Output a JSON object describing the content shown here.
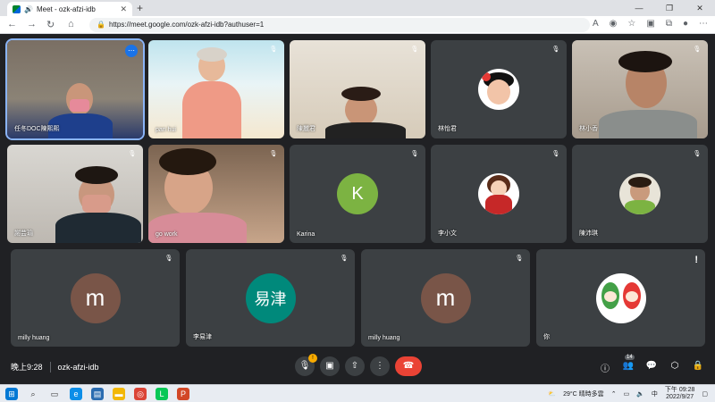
{
  "browser": {
    "tab_title": "Meet - ozk-afzi-idb",
    "new_tab": "+",
    "url": "https://meet.google.com/ozk-afzi-idb?authuser=1",
    "window_controls": [
      "—",
      "❐",
      "✕"
    ]
  },
  "tiles": [
    {
      "name": "任冬DOC陳熙熙",
      "kind": "video"
    },
    {
      "name": "pan hui",
      "kind": "video"
    },
    {
      "name": "陳麗君",
      "kind": "video"
    },
    {
      "name": "林怡君",
      "kind": "picture"
    },
    {
      "name": "林小香",
      "kind": "video"
    },
    {
      "name": "謝芸瑜",
      "kind": "video"
    },
    {
      "name": "go work",
      "kind": "video"
    },
    {
      "name": "Karina",
      "kind": "letter",
      "letter": "K",
      "color": "#7cb342"
    },
    {
      "name": "李小文",
      "kind": "picture"
    },
    {
      "name": "陳沛琪",
      "kind": "picture"
    },
    {
      "name": "milly huang",
      "kind": "letter",
      "letter": "m",
      "color": "#795548"
    },
    {
      "name": "李易津",
      "kind": "letter",
      "letter": "易津",
      "color": "#00897b"
    },
    {
      "name": "milly huang",
      "kind": "letter",
      "letter": "m",
      "color": "#795548"
    },
    {
      "name": "你",
      "kind": "picture"
    }
  ],
  "bottom": {
    "time": "晚上9:28",
    "meeting_code": "ozk-afzi-idb",
    "mic_badge": "!",
    "people_count": "14"
  },
  "taskbar": {
    "weather": "29°C 晴時多雲",
    "ime": "中",
    "time": "下午 09:28",
    "date": "2022/9/27"
  }
}
